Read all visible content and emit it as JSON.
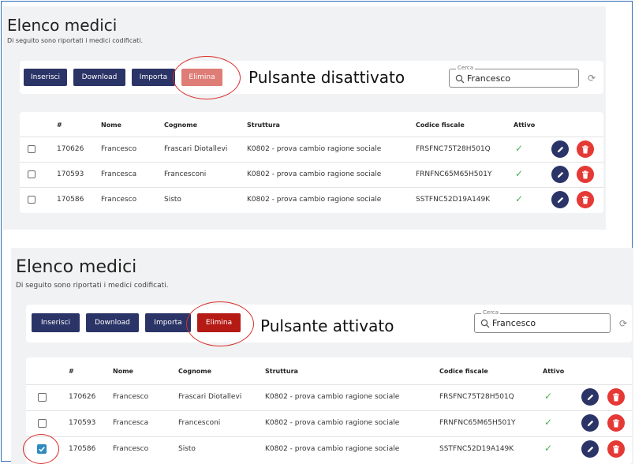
{
  "top": {
    "title": "Elenco medici",
    "subtitle": "Di seguito sono riportati i medici codificati.",
    "buttons": {
      "insert": "Inserisci",
      "download": "Download",
      "import": "Importa",
      "delete": "Elimina"
    },
    "annotation": "Pulsante disattivato",
    "search": {
      "legend": "Cerca",
      "value": "Francesco"
    },
    "table": {
      "headers": [
        "#",
        "Nome",
        "Cognome",
        "Struttura",
        "Codice fiscale",
        "Attivo"
      ],
      "rows": [
        {
          "id": "170626",
          "nome": "Francesco",
          "cognome": "Frascari Diotallevi",
          "struttura": "K0802 - prova cambio ragione sociale",
          "cf": "FRSFNC75T28H501Q"
        },
        {
          "id": "170593",
          "nome": "Francesca",
          "cognome": "Francesconi",
          "struttura": "K0802 - prova cambio ragione sociale",
          "cf": "FRNFNC65M65H501Y"
        },
        {
          "id": "170586",
          "nome": "Francesco",
          "cognome": "Sisto",
          "struttura": "K0802 - prova cambio ragione sociale",
          "cf": "SSTFNC52D19A149K"
        }
      ]
    }
  },
  "bottom": {
    "title": "Elenco medici",
    "subtitle": "Di seguito sono riportati i medici codificati.",
    "buttons": {
      "insert": "Inserisci",
      "download": "Download",
      "import": "Importa",
      "delete": "Elimina"
    },
    "annotation": "Pulsante attivato",
    "search": {
      "legend": "Cerca",
      "value": "Francesco"
    },
    "table": {
      "headers": [
        "#",
        "Nome",
        "Cognome",
        "Struttura",
        "Codice fiscale",
        "Attivo"
      ],
      "rows": [
        {
          "id": "170626",
          "nome": "Francesco",
          "cognome": "Frascari Diotallevi",
          "struttura": "K0802 - prova cambio ragione sociale",
          "cf": "FRSFNC75T28H501Q"
        },
        {
          "id": "170593",
          "nome": "Francesca",
          "cognome": "Francesconi",
          "struttura": "K0802 - prova cambio ragione sociale",
          "cf": "FRNFNC65M65H501Y"
        },
        {
          "id": "170586",
          "nome": "Francesco",
          "cognome": "Sisto",
          "struttura": "K0802 - prova cambio ragione sociale",
          "cf": "SSTFNC52D19A149K"
        }
      ]
    }
  },
  "icons": {
    "tick": "✓",
    "refresh": "⟳"
  },
  "colors": {
    "primary": "#2b3467",
    "delete_disabled": "#de7c76",
    "delete_active": "#b51a15",
    "danger": "#e53935",
    "check": "#4caf50",
    "annotation": "#d9302b"
  }
}
